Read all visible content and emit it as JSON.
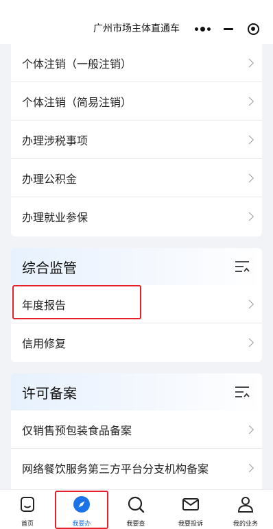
{
  "header": {
    "title": "广州市场主体直通车"
  },
  "top_list": [
    "个体注销（一般注销）",
    "个体注销（简易注销）",
    "办理涉税事项",
    "办理公积金",
    "办理就业参保"
  ],
  "sections": [
    {
      "title": "综合监管",
      "items": [
        "年度报告",
        "信用修复"
      ]
    },
    {
      "title": "许可备案",
      "items": [
        "仅销售预包装食品备案",
        "网络餐饮服务第三方平台分支机构备案"
      ]
    }
  ],
  "tabs": [
    {
      "label": "首页"
    },
    {
      "label": "我要办",
      "active": true
    },
    {
      "label": "我要查"
    },
    {
      "label": "我要投诉"
    },
    {
      "label": "我的业务"
    }
  ],
  "colors": {
    "accent": "#1a73e8",
    "highlight": "#e5202a"
  }
}
